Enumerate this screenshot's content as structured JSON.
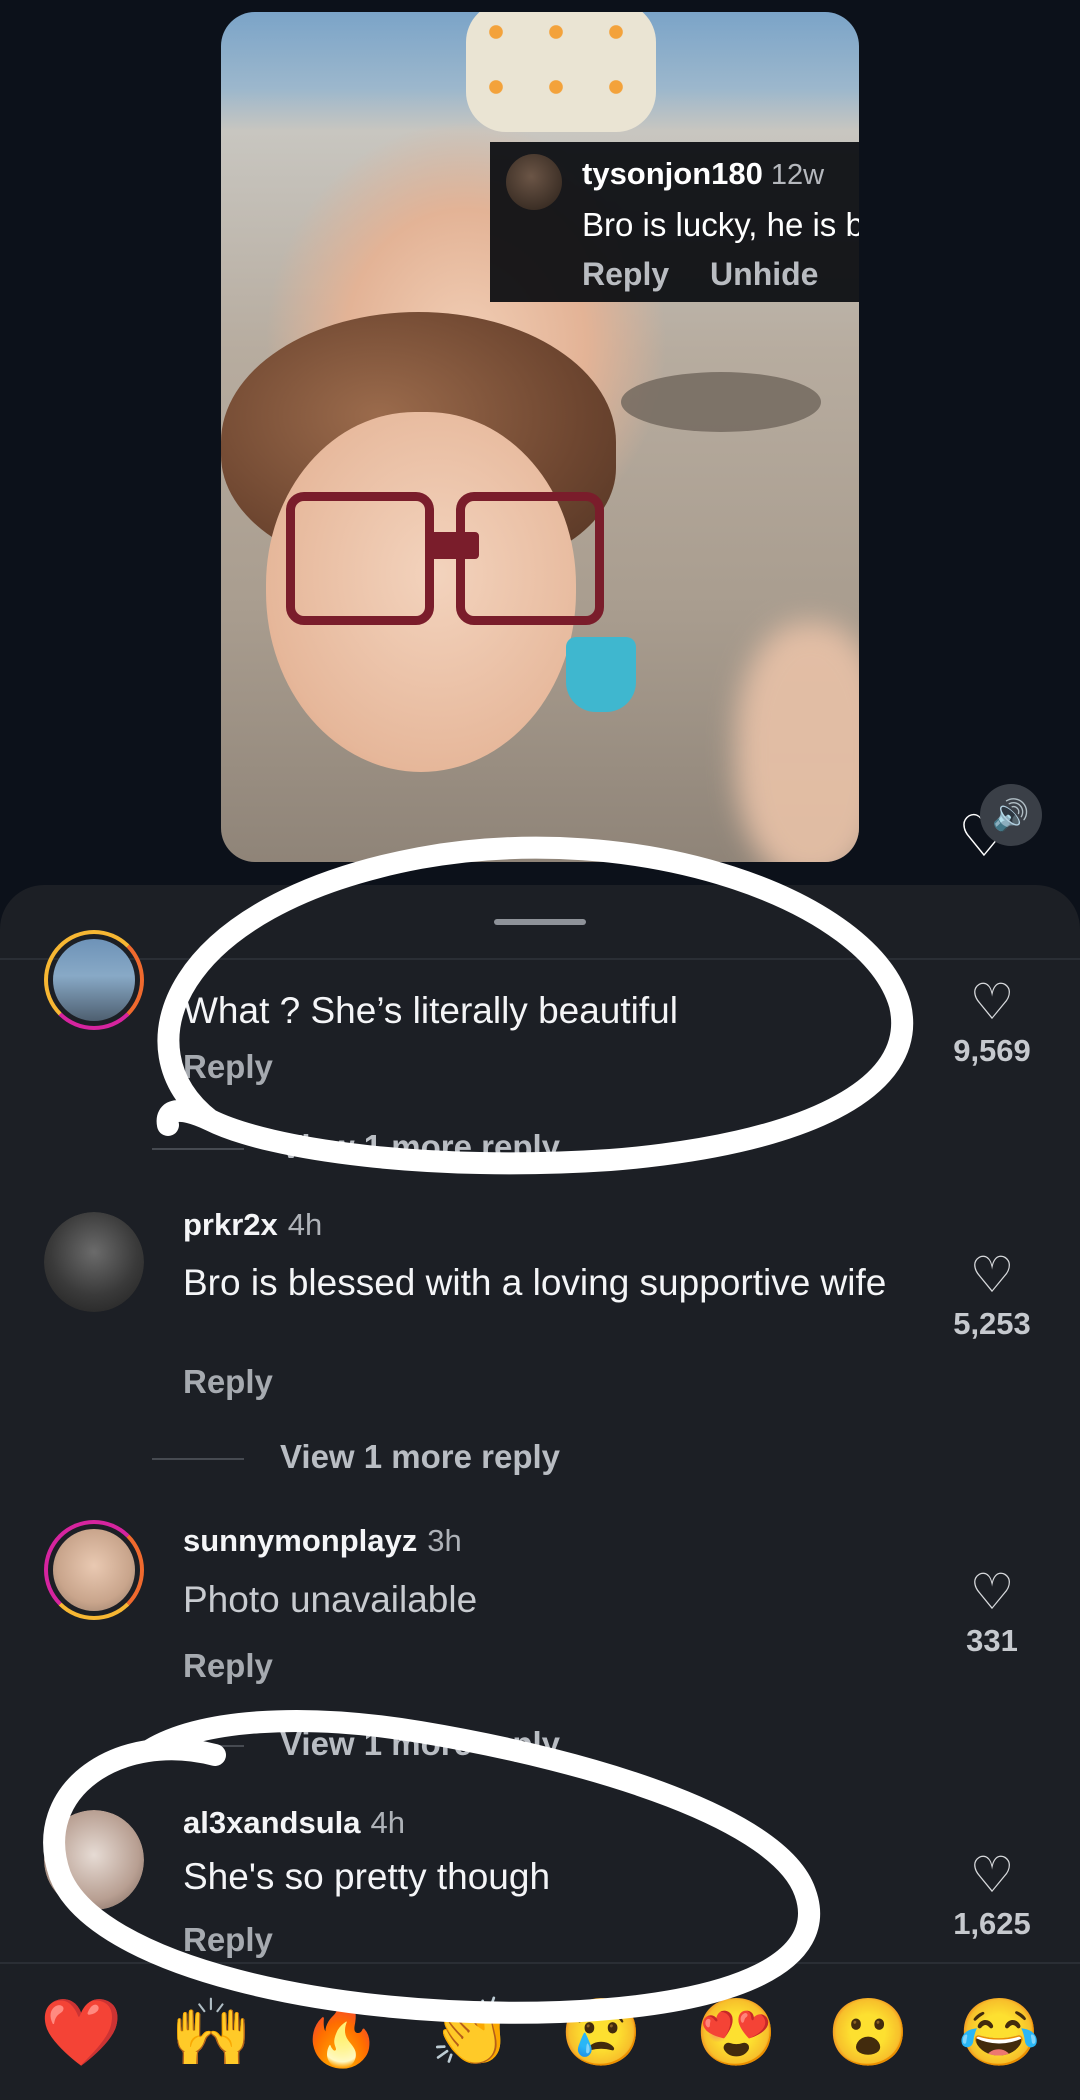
{
  "overlay_comment": {
    "username": "tysonjon180",
    "time": "12w",
    "text": "Bro is lucky, he is blind.",
    "actions": [
      "Reply",
      "Unhide"
    ]
  },
  "comments": [
    {
      "username": "",
      "time": "",
      "text": "What ? She’s literally beautiful",
      "reply": "Reply",
      "likes": "9,569",
      "view_more": "View 1 more reply"
    },
    {
      "username": "prkr2x",
      "time": "4h",
      "text": "Bro is blessed with a loving supportive wife",
      "reply": "Reply",
      "likes": "5,253",
      "view_more": "View 1 more reply"
    },
    {
      "username": "sunnymonplayz",
      "time": "3h",
      "text": "Photo unavailable",
      "reply": "Reply",
      "likes": "331",
      "view_more": "View 1 more reply"
    },
    {
      "username": "al3xandsula",
      "time": "4h",
      "text": "She's so pretty though",
      "reply": "Reply",
      "likes": "1,625"
    }
  ],
  "emoji_bar": [
    "❤️",
    "🙌",
    "🔥",
    "👏",
    "😢",
    "😍",
    "😮",
    "😂"
  ],
  "icons": {
    "like": "heart-outline-icon",
    "sound": "speaker-icon"
  },
  "colors": {
    "background": "#0c111a",
    "sheet": "#1c1f25",
    "ring": "#f7b733",
    "heart_emoji": "#ff3040"
  }
}
